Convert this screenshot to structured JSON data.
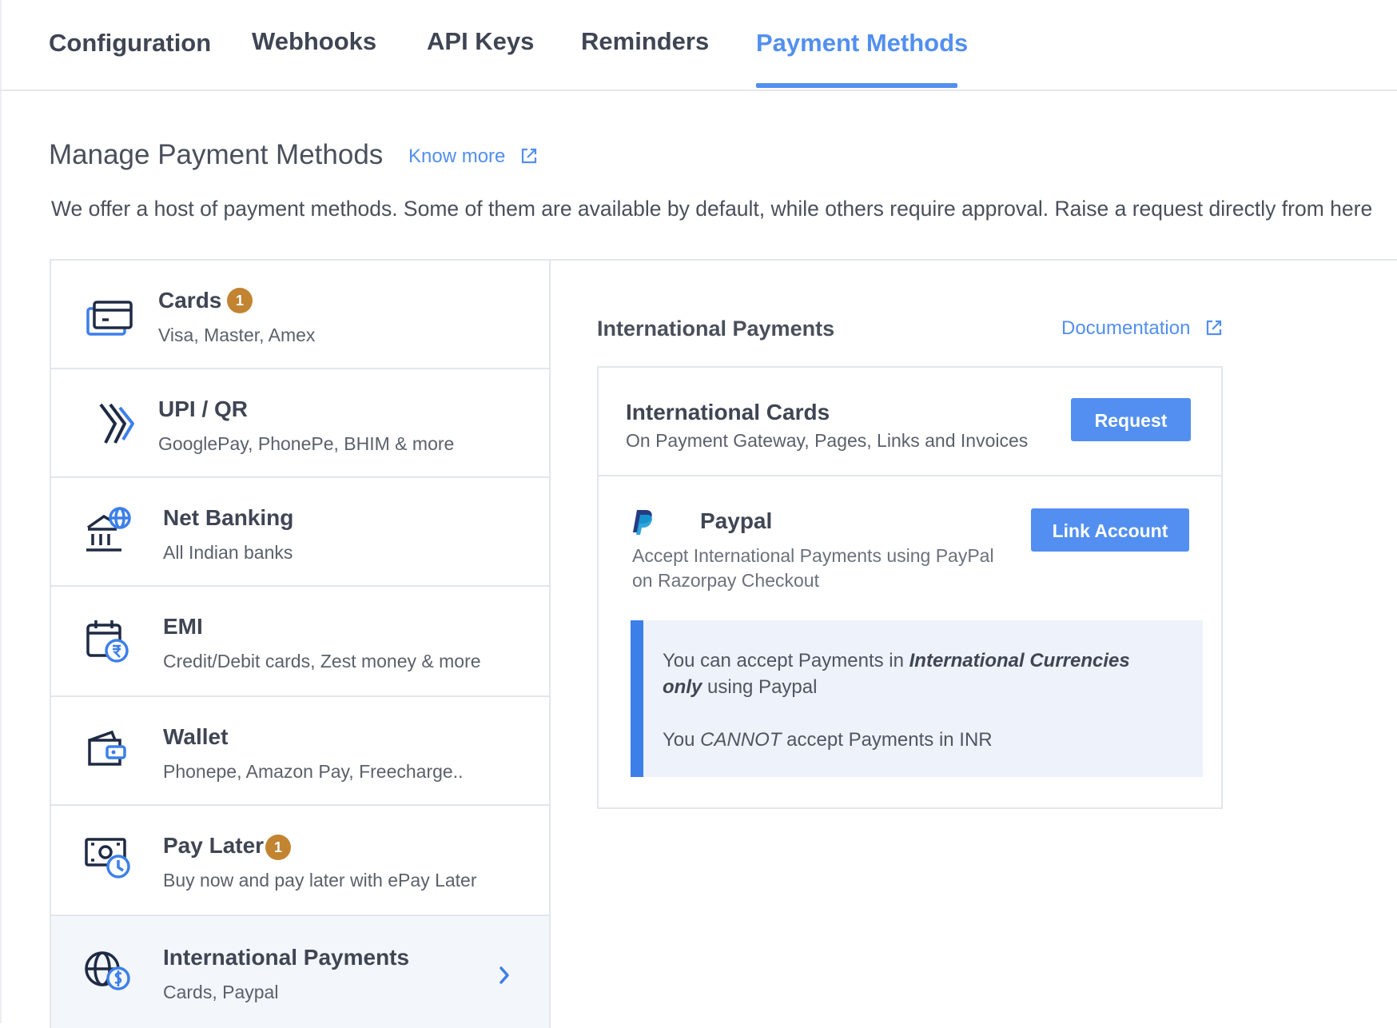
{
  "tabs": [
    {
      "label": "Configuration",
      "active": false
    },
    {
      "label": "Webhooks",
      "active": false
    },
    {
      "label": "API Keys",
      "active": false
    },
    {
      "label": "Reminders",
      "active": false
    },
    {
      "label": "Payment Methods",
      "active": true
    }
  ],
  "header": {
    "title": "Manage Payment Methods",
    "know_more": "Know more",
    "description": "We offer a host of payment methods. Some of them are available by default, while others require approval. Raise a request directly from here"
  },
  "methods": [
    {
      "name": "Cards",
      "sub": "Visa, Master, Amex",
      "badge": "1",
      "icon": "credit-card-icon"
    },
    {
      "name": "UPI / QR",
      "sub": "GooglePay, PhonePe, BHIM & more",
      "icon": "upi-icon"
    },
    {
      "name": "Net Banking",
      "sub": "All Indian banks",
      "icon": "bank-globe-icon"
    },
    {
      "name": "EMI",
      "sub": "Credit/Debit cards, Zest money & more",
      "icon": "calendar-rupee-icon"
    },
    {
      "name": "Wallet",
      "sub": "Phonepe, Amazon Pay, Freecharge..",
      "icon": "wallet-icon"
    },
    {
      "name": "Pay Later",
      "sub": "Buy now and pay later with ePay Later",
      "badge": "1",
      "icon": "cash-clock-icon"
    },
    {
      "name": "International Payments",
      "sub": "Cards, Paypal",
      "icon": "globe-dollar-icon",
      "selected": true
    }
  ],
  "detail": {
    "title": "International Payments",
    "documentation": "Documentation",
    "intl_cards": {
      "title": "International Cards",
      "sub": "On Payment Gateway, Pages, Links and Invoices",
      "button": "Request"
    },
    "paypal": {
      "title": "Paypal",
      "desc": "Accept International Payments using PayPal on Razorpay Checkout",
      "button": "Link Account",
      "info": {
        "line1_pre": "You can accept Payments in ",
        "line1_em": "International Currencies only",
        "line1_post": " using Paypal",
        "line2_pre": "You ",
        "line2_em": "CANNOT",
        "line2_post": " accept Payments in INR"
      }
    }
  },
  "colors": {
    "accent": "#528ff0",
    "badge": "#c28431",
    "info_bar": "#3c7fe9",
    "info_bg": "#eef2fb"
  }
}
